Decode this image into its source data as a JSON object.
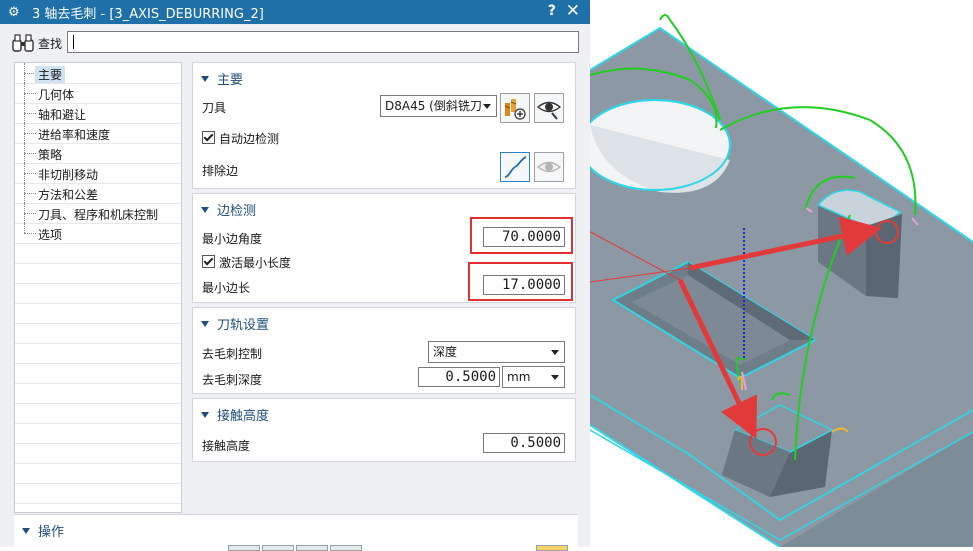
{
  "titlebar": {
    "title": "3 轴去毛刺 - [3_AXIS_DEBURRING_2]",
    "help": "?",
    "close": "✕",
    "icon": "gear-icon"
  },
  "search": {
    "label": "查找",
    "value": "",
    "icon": "binoculars-icon"
  },
  "nav": {
    "items": [
      {
        "label": "主要",
        "selected": true
      },
      {
        "label": "几何体"
      },
      {
        "label": "轴和避让"
      },
      {
        "label": "进给率和速度"
      },
      {
        "label": "策略"
      },
      {
        "label": "非切削移动"
      },
      {
        "label": "方法和公差"
      },
      {
        "label": "刀具、程序和机床控制"
      },
      {
        "label": "选项"
      }
    ]
  },
  "main": {
    "header": "主要",
    "tool_label": "刀具",
    "tool_value": "D8A45 (倒斜铣刀",
    "auto_edge_label": "自动边检测",
    "auto_edge_checked": true,
    "exclude_edge_label": "排除边"
  },
  "edge": {
    "header": "边检测",
    "min_angle_label": "最小边角度",
    "min_angle_value": "70.0000",
    "activate_min_len_label": "激活最小长度",
    "activate_min_len_checked": true,
    "min_len_label": "最小边长",
    "min_len_value": "17.0000"
  },
  "toolpath": {
    "header": "刀轨设置",
    "control_label": "去毛刺控制",
    "control_value": "深度",
    "depth_label": "去毛刺深度",
    "depth_value": "0.5000",
    "depth_unit": "mm"
  },
  "contact": {
    "header": "接触高度",
    "label": "接触高度",
    "value": "0.5000"
  },
  "actions": {
    "header": "操作"
  },
  "colors": {
    "title_bar": "#1f6fa8",
    "header_text": "#1f4f7a",
    "highlight": "#e23030",
    "edge_cyan": "#2fd6e8",
    "path_green": "#22cc22",
    "part_gray": "#8c99a5"
  }
}
